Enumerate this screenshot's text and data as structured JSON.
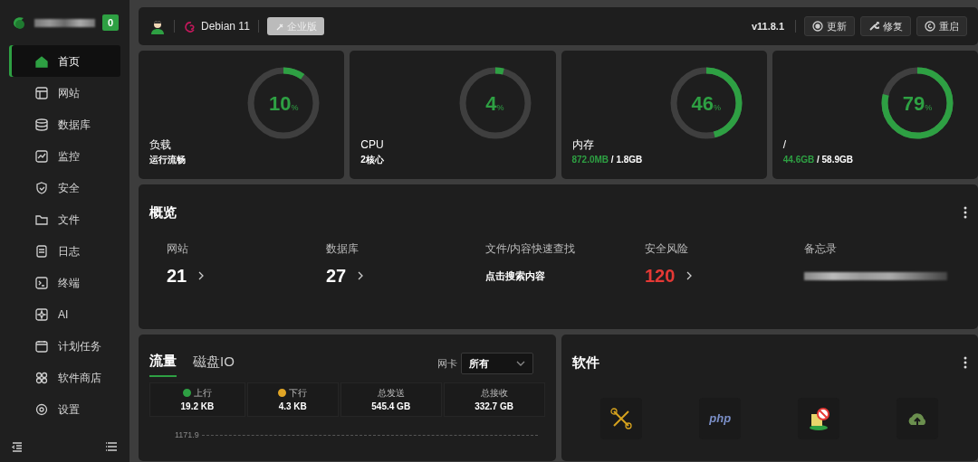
{
  "sidebar": {
    "badge": "0",
    "items": [
      {
        "label": "首页",
        "selected": true
      },
      {
        "label": "网站",
        "selected": false
      },
      {
        "label": "数据库",
        "selected": false
      },
      {
        "label": "监控",
        "selected": false
      },
      {
        "label": "安全",
        "selected": false
      },
      {
        "label": "文件",
        "selected": false
      },
      {
        "label": "日志",
        "selected": false
      },
      {
        "label": "终端",
        "selected": false
      },
      {
        "label": "AI",
        "selected": false
      },
      {
        "label": "计划任务",
        "selected": false
      },
      {
        "label": "软件商店",
        "selected": false
      },
      {
        "label": "设置",
        "selected": false
      }
    ]
  },
  "header": {
    "os": "Debian 11",
    "edition": "企业版",
    "version": "v11.8.1",
    "buttons": [
      "更新",
      "修复",
      "重启"
    ]
  },
  "stats": [
    {
      "value": "10",
      "unit": "%",
      "level": 0.1,
      "label": "负载",
      "detail": "运行流畅"
    },
    {
      "value": "4",
      "unit": "%",
      "level": 0.04,
      "label": "CPU",
      "detail": "2核心"
    },
    {
      "value": "46",
      "unit": "%",
      "level": 0.46,
      "label": "内存",
      "used": "872.0MB",
      "detail": " / 1.8GB"
    },
    {
      "value": "79",
      "unit": "%",
      "level": 0.79,
      "label": "/",
      "used": "44.6GB",
      "detail": " / 58.9GB"
    }
  ],
  "overview": {
    "title": "概览",
    "items": [
      {
        "kind": "count",
        "label": "网站",
        "value": "21"
      },
      {
        "kind": "count",
        "label": "数据库",
        "value": "27"
      },
      {
        "kind": "link",
        "label": "文件/内容快速查找",
        "value": "点击搜索内容"
      },
      {
        "kind": "alert",
        "label": "安全风险",
        "value": "120"
      },
      {
        "kind": "memo",
        "label": "备忘录"
      }
    ]
  },
  "traffic": {
    "tabs": [
      {
        "label": "流量",
        "selected": true
      },
      {
        "label": "磁盘IO",
        "selected": false
      }
    ],
    "nic_label": "网卡",
    "nic_value": "所有",
    "stats": [
      {
        "label": "上行",
        "value": "19.2 KB",
        "color": "#2ea043"
      },
      {
        "label": "下行",
        "value": "4.3 KB",
        "color": "#e0a526"
      },
      {
        "label": "总发送",
        "value": "545.4 GB"
      },
      {
        "label": "总接收",
        "value": "332.7 GB"
      }
    ],
    "y_tick": "1171.9"
  },
  "software": {
    "title": "软件",
    "items": [
      {
        "kind": "tools"
      },
      {
        "kind": "php",
        "label": "php"
      },
      {
        "kind": "firewall"
      },
      {
        "kind": "cloud"
      }
    ]
  }
}
